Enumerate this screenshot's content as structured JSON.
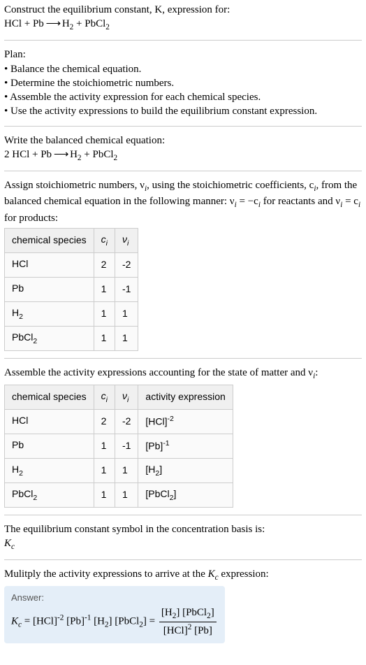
{
  "prompt": {
    "line1": "Construct the equilibrium constant, K, expression for:",
    "eq_left": "HCl + Pb",
    "eq_arrow": " ⟶ ",
    "eq_right_part1": "H",
    "eq_right_sub1": "2",
    "eq_right_part2": " + PbCl",
    "eq_right_sub2": "2"
  },
  "plan": {
    "title": "Plan:",
    "b1": "• Balance the chemical equation.",
    "b2": "• Determine the stoichiometric numbers.",
    "b3": "• Assemble the activity expression for each chemical species.",
    "b4": "• Use the activity expressions to build the equilibrium constant expression."
  },
  "balanced": {
    "title": "Write the balanced chemical equation:",
    "left": "2 HCl + Pb",
    "arrow": " ⟶ ",
    "right_h": "H",
    "right_h_sub": "2",
    "right_mid": " + PbCl",
    "right_pb_sub": "2"
  },
  "assign": {
    "text_a": "Assign stoichiometric numbers, ν",
    "text_a_sub": "i",
    "text_b": ", using the stoichiometric coefficients, c",
    "text_b_sub": "i",
    "text_c": ", from the balanced chemical equation in the following manner: ν",
    "text_c_sub": "i",
    "text_d": " = −c",
    "text_d_sub": "i",
    "text_e": " for reactants and ν",
    "text_e_sub": "i",
    "text_f": " = c",
    "text_f_sub": "i",
    "text_g": " for products:"
  },
  "table1": {
    "h1": "chemical species",
    "h2_pre": "c",
    "h2_sub": "i",
    "h3_pre": "ν",
    "h3_sub": "i",
    "rows": [
      {
        "species_a": "HCl",
        "species_b": "",
        "c": "2",
        "v": "-2"
      },
      {
        "species_a": "Pb",
        "species_b": "",
        "c": "1",
        "v": "-1"
      },
      {
        "species_a": "H",
        "species_b": "2",
        "c": "1",
        "v": "1"
      },
      {
        "species_a": "PbCl",
        "species_b": "2",
        "c": "1",
        "v": "1"
      }
    ]
  },
  "assemble": {
    "text_a": "Assemble the activity expressions accounting for the state of matter and ν",
    "text_a_sub": "i",
    "text_b": ":"
  },
  "table2": {
    "h1": "chemical species",
    "h2_pre": "c",
    "h2_sub": "i",
    "h3_pre": "ν",
    "h3_sub": "i",
    "h4": "activity expression",
    "rows": [
      {
        "species_a": "HCl",
        "species_b": "",
        "c": "2",
        "v": "-2",
        "act_a": "[HCl]",
        "act_sup": "-2",
        "act_sub": ""
      },
      {
        "species_a": "Pb",
        "species_b": "",
        "c": "1",
        "v": "-1",
        "act_a": "[Pb]",
        "act_sup": "-1",
        "act_sub": ""
      },
      {
        "species_a": "H",
        "species_b": "2",
        "c": "1",
        "v": "1",
        "act_a": "[H",
        "act_sup": "",
        "act_sub": "2",
        "act_close": "]"
      },
      {
        "species_a": "PbCl",
        "species_b": "2",
        "c": "1",
        "v": "1",
        "act_a": "[PbCl",
        "act_sup": "",
        "act_sub": "2",
        "act_close": "]"
      }
    ]
  },
  "concbasis": {
    "text": "The equilibrium constant symbol in the concentration basis is:",
    "sym_pre": "K",
    "sym_sub": "c"
  },
  "multiply": {
    "text_a": "Mulitply the activity expressions to arrive at the ",
    "sym_pre": "K",
    "sym_sub": "c",
    "text_b": " expression:"
  },
  "answer": {
    "label": "Answer:",
    "kc_pre": "K",
    "kc_sub": "c",
    "eq": " = [HCl]",
    "p1_sup": "-2",
    "p2": " [Pb]",
    "p2_sup": "-1",
    "p3": " [H",
    "p3_sub": "2",
    "p4": "] [PbCl",
    "p4_sub": "2",
    "p5": "] = ",
    "num_a": "[H",
    "num_a_sub": "2",
    "num_b": "] [PbCl",
    "num_b_sub": "2",
    "num_c": "]",
    "den_a": "[HCl]",
    "den_a_sup": "2",
    "den_b": " [Pb]"
  }
}
